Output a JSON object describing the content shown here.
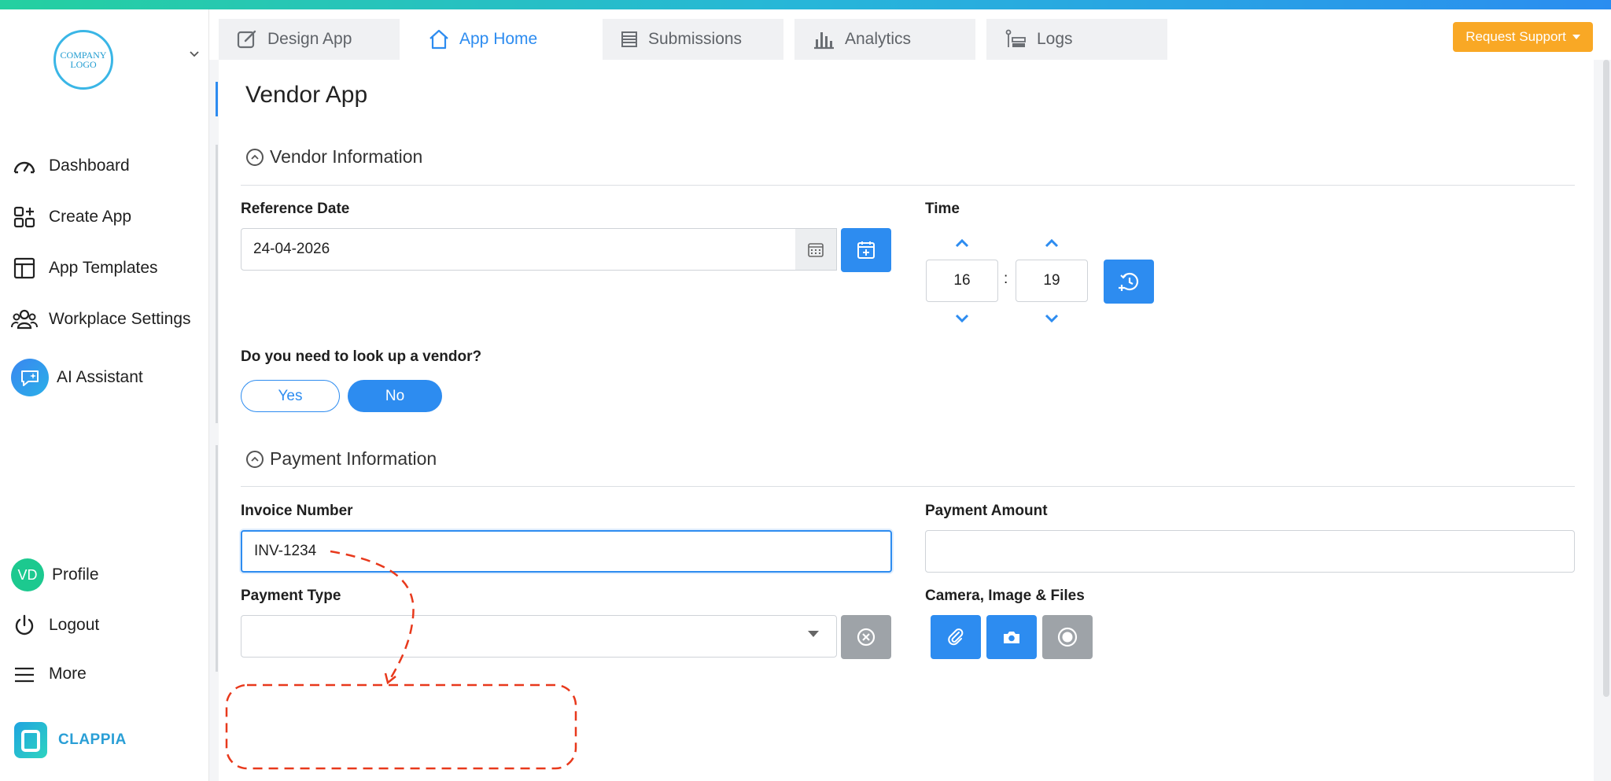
{
  "sidebar": {
    "logo_text_line1": "COMPANY",
    "logo_text_line2": "LOGO",
    "items": [
      {
        "label": "Dashboard",
        "icon": "gauge-icon"
      },
      {
        "label": "Create App",
        "icon": "create-app-icon"
      },
      {
        "label": "App Templates",
        "icon": "templates-icon"
      },
      {
        "label": "Workplace Settings",
        "icon": "people-icon"
      },
      {
        "label": "AI Assistant",
        "icon": "ai-chat-icon"
      }
    ],
    "bottom_items": [
      {
        "label": "Profile",
        "avatar": "VD"
      },
      {
        "label": "Logout",
        "icon": "power-icon"
      },
      {
        "label": "More",
        "icon": "hamburger-icon"
      }
    ],
    "brand": "CLAPPIA"
  },
  "tabs": [
    {
      "label": "Design App",
      "icon": "edit-icon",
      "active": false
    },
    {
      "label": "App Home",
      "icon": "home-icon",
      "active": true
    },
    {
      "label": "Submissions",
      "icon": "list-icon",
      "active": false
    },
    {
      "label": "Analytics",
      "icon": "bar-chart-icon",
      "active": false
    },
    {
      "label": "Logs",
      "icon": "logs-icon",
      "active": false
    }
  ],
  "support_button": "Request Support",
  "page_title": "Vendor App",
  "sections": {
    "vendor": "Vendor Information",
    "payment": "Payment Information"
  },
  "fields": {
    "reference_date_label": "Reference Date",
    "reference_date_value": "24-04-2026",
    "time_label": "Time",
    "time_hours": "16",
    "time_separator": ":",
    "time_minutes": "19",
    "lookup_label": "Do you need to look up a vendor?",
    "lookup_yes": "Yes",
    "lookup_no": "No",
    "lookup_selected": "No",
    "invoice_label": "Invoice Number",
    "invoice_value": "INV-1234",
    "amount_label": "Payment Amount",
    "amount_value": "",
    "payment_type_label": "Payment Type",
    "payment_type_value": "",
    "camera_label": "Camera, Image & Files"
  },
  "colors": {
    "accent": "#2d8cf0",
    "support": "#f9a825",
    "annotation": "#e8391c",
    "avatar": "#1cc98f"
  }
}
